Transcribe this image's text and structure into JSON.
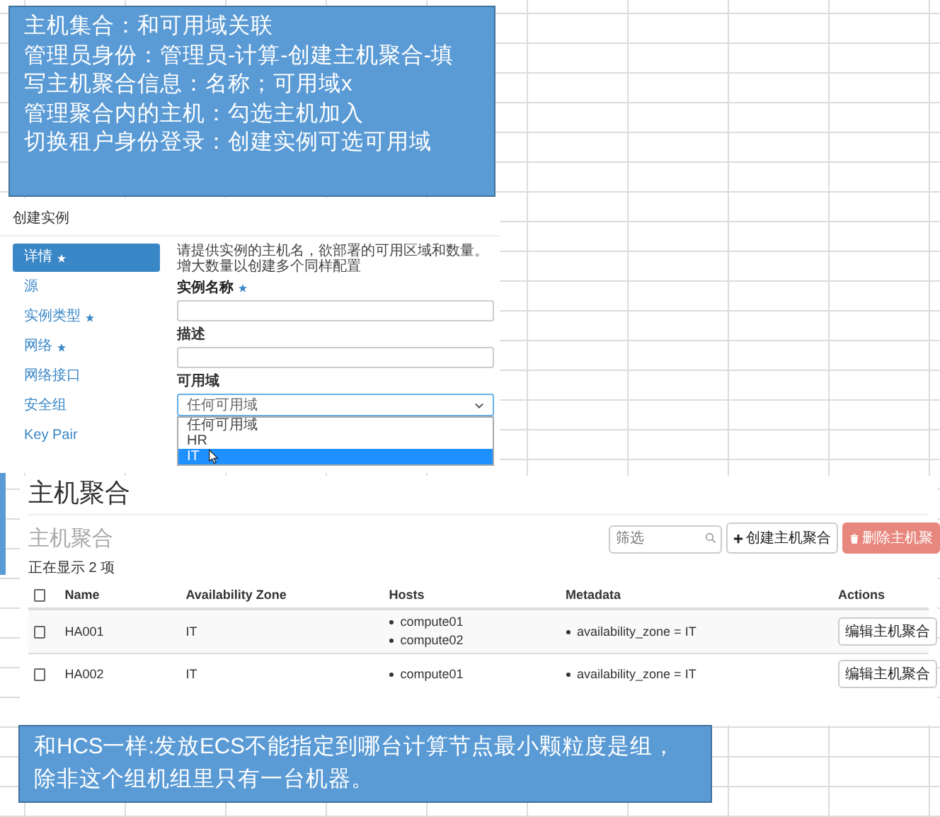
{
  "note_top": {
    "lines": [
      "主机集合：和可用域关联",
      "管理员身份：管理员-计算-创建主机聚合-填",
      "写主机聚合信息：名称；可用域x",
      "管理聚合内的主机：勾选主机加入",
      "切换租户身份登录：创建实例可选可用域"
    ]
  },
  "create_instance": {
    "title": "创建实例",
    "steps": [
      {
        "label": "详情",
        "required": true,
        "selected": true
      },
      {
        "label": "源",
        "required": false,
        "selected": false
      },
      {
        "label": "实例类型",
        "required": true,
        "selected": false
      },
      {
        "label": "网络",
        "required": true,
        "selected": false
      },
      {
        "label": "网络接口",
        "required": false,
        "selected": false
      },
      {
        "label": "安全组",
        "required": false,
        "selected": false
      },
      {
        "label": "Key Pair",
        "required": false,
        "selected": false
      }
    ],
    "intro": [
      "请提供实例的主机名，欲部署的可用区域和数量。",
      "增大数量以创建多个同样配置"
    ],
    "fields": [
      {
        "label": "实例名称",
        "required": true
      },
      {
        "label": "描述",
        "required": false
      }
    ],
    "zone": {
      "label": "可用域",
      "value": "任何可用域",
      "options": [
        {
          "label": "任何可用域",
          "highlighted": false
        },
        {
          "label": "HR",
          "highlighted": false
        },
        {
          "label": "IT",
          "highlighted": true
        }
      ]
    }
  },
  "aggregates": {
    "title": "主机聚合",
    "subtitle": "主机聚合",
    "filter": {
      "placeholder": "筛选"
    },
    "buttons": [
      {
        "kind": "create",
        "label": "创建主机聚合"
      },
      {
        "kind": "delete",
        "label": "删除主机聚"
      }
    ],
    "count": "正在显示 2 项",
    "header_checked": false,
    "columns": [
      "Name",
      "Availability Zone",
      "Hosts",
      "Metadata",
      "Actions"
    ],
    "rows": [
      {
        "checked": false,
        "name": "HA001",
        "zone": "IT",
        "hosts": [
          "compute01",
          "compute02"
        ],
        "metadata": [
          "availability_zone = IT"
        ],
        "action": "编辑主机聚合"
      },
      {
        "checked": false,
        "name": "HA002",
        "zone": "IT",
        "hosts": [
          "compute01"
        ],
        "metadata": [
          "availability_zone = IT"
        ],
        "action": "编辑主机聚合"
      }
    ]
  },
  "note_bottom": {
    "text": "和HCS一样:发放ECS不能指定到哪台计算节点最小颗粒度是组，除非这个组机组里只有一台机器。"
  }
}
